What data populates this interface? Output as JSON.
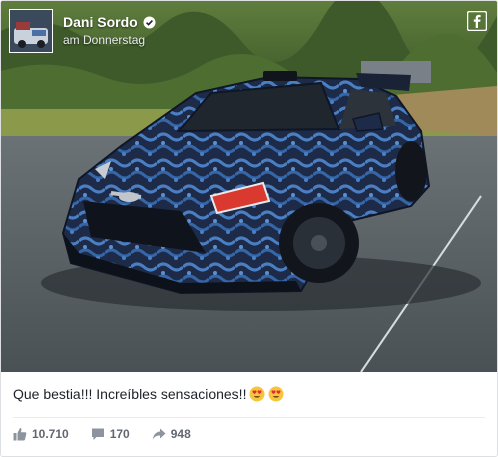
{
  "post": {
    "author": "Dani Sordo",
    "date": "am Donnerstag",
    "caption": "Que bestia!!! Increíbles sensaciones!!",
    "likes": "10.710",
    "comments": "170",
    "shares": "948"
  },
  "icons": {
    "verified": "verified-badge-icon",
    "platform": "facebook-icon",
    "like": "thumbs-up-icon",
    "comment": "comment-bubble-icon",
    "share": "share-arrow-icon",
    "emoji": "heart-eyes-emoji-icon"
  },
  "colors": {
    "text": "#1d2129",
    "muted": "#616770",
    "divider": "#e9ebee",
    "car_body": "#1f2c4a",
    "car_camo": "#3c6fb3"
  }
}
